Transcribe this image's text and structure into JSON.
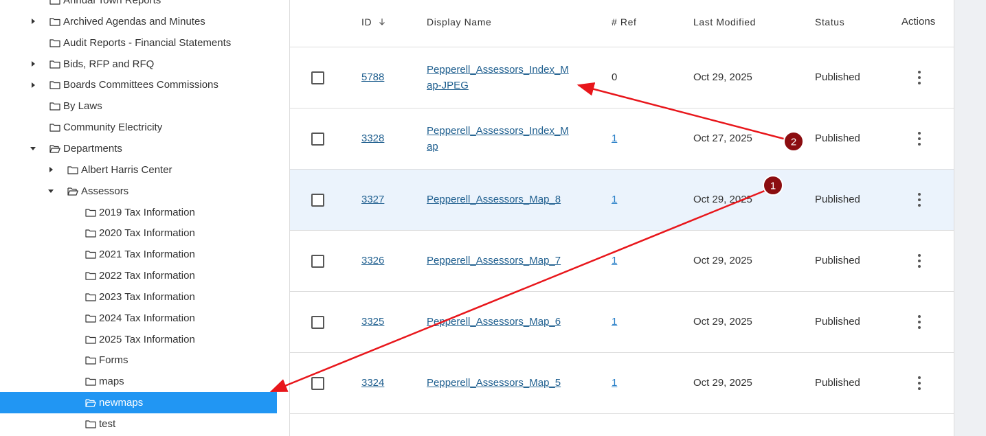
{
  "sidebar": {
    "items": [
      {
        "label": "Annual Town Reports",
        "caret": "none",
        "open": false,
        "selected": false
      },
      {
        "label": "Archived Agendas and Minutes",
        "caret": "right",
        "open": false,
        "selected": false
      },
      {
        "label": "Audit Reports - Financial Statements",
        "caret": "none",
        "open": false,
        "selected": false
      },
      {
        "label": "Bids, RFP and RFQ",
        "caret": "right",
        "open": false,
        "selected": false
      },
      {
        "label": "Boards Committees Commissions",
        "caret": "right",
        "open": false,
        "selected": false
      },
      {
        "label": "By Laws",
        "caret": "none",
        "open": false,
        "selected": false
      },
      {
        "label": "Community Electricity",
        "caret": "none",
        "open": false,
        "selected": false
      },
      {
        "label": "Departments",
        "caret": "down",
        "open": true,
        "selected": false
      },
      {
        "label": "Albert Harris Center",
        "caret": "right",
        "open": false,
        "selected": false
      },
      {
        "label": "Assessors",
        "caret": "down",
        "open": true,
        "selected": false
      },
      {
        "label": "2019 Tax Information",
        "caret": "none",
        "open": false,
        "selected": false
      },
      {
        "label": "2020 Tax Information",
        "caret": "none",
        "open": false,
        "selected": false
      },
      {
        "label": "2021 Tax Information",
        "caret": "none",
        "open": false,
        "selected": false
      },
      {
        "label": "2022 Tax Information",
        "caret": "none",
        "open": false,
        "selected": false
      },
      {
        "label": "2023 Tax Information",
        "caret": "none",
        "open": false,
        "selected": false
      },
      {
        "label": "2024 Tax Information",
        "caret": "none",
        "open": false,
        "selected": false
      },
      {
        "label": "2025 Tax Information",
        "caret": "none",
        "open": false,
        "selected": false
      },
      {
        "label": "Forms",
        "caret": "none",
        "open": false,
        "selected": false
      },
      {
        "label": "maps",
        "caret": "none",
        "open": false,
        "selected": false
      },
      {
        "label": "newmaps",
        "caret": "none",
        "open": true,
        "selected": true
      },
      {
        "label": "test",
        "caret": "none",
        "open": false,
        "selected": false
      }
    ]
  },
  "table": {
    "headers": {
      "id": "ID",
      "sort_icon": "arrow-down-icon",
      "display_name": "Display Name",
      "ref": "# Ref",
      "last_modified": "Last Modified",
      "status": "Status",
      "actions": "Actions"
    },
    "rows": [
      {
        "id": "5788",
        "name_line1": "Pepperell_Assessors_Index_M",
        "name_line2": "ap-JPEG",
        "ref": "0",
        "ref_is_link": false,
        "modified": "Oct 29, 2025",
        "status": "Published",
        "highlight": false
      },
      {
        "id": "3328",
        "name_line1": "Pepperell_Assessors_Index_M",
        "name_line2": "ap",
        "ref": "1",
        "ref_is_link": true,
        "modified": "Oct 27, 2025",
        "status": "Published",
        "highlight": false
      },
      {
        "id": "3327",
        "name_line1": "Pepperell_Assessors_Map_8",
        "name_line2": "",
        "ref": "1",
        "ref_is_link": true,
        "modified": "Oct 29, 2025",
        "status": "Published",
        "highlight": true
      },
      {
        "id": "3326",
        "name_line1": "Pepperell_Assessors_Map_7",
        "name_line2": "",
        "ref": "1",
        "ref_is_link": true,
        "modified": "Oct 29, 2025",
        "status": "Published",
        "highlight": false
      },
      {
        "id": "3325",
        "name_line1": "Pepperell_Assessors_Map_6",
        "name_line2": "",
        "ref": "1",
        "ref_is_link": true,
        "modified": "Oct 29, 2025",
        "status": "Published",
        "highlight": false
      },
      {
        "id": "3324",
        "name_line1": "Pepperell_Assessors_Map_5",
        "name_line2": "",
        "ref": "1",
        "ref_is_link": true,
        "modified": "Oct 29, 2025",
        "status": "Published",
        "highlight": false
      }
    ]
  },
  "annotations": {
    "badges": [
      {
        "number": "1"
      },
      {
        "number": "2"
      }
    ],
    "arrow_color": "#e8161b",
    "badge_color": "#8b0d10"
  },
  "colors": {
    "selected_bg": "#2196f3",
    "row_highlight": "#ebf3fc",
    "link": "#1f5f8f",
    "ref_link": "#2a80c8"
  }
}
